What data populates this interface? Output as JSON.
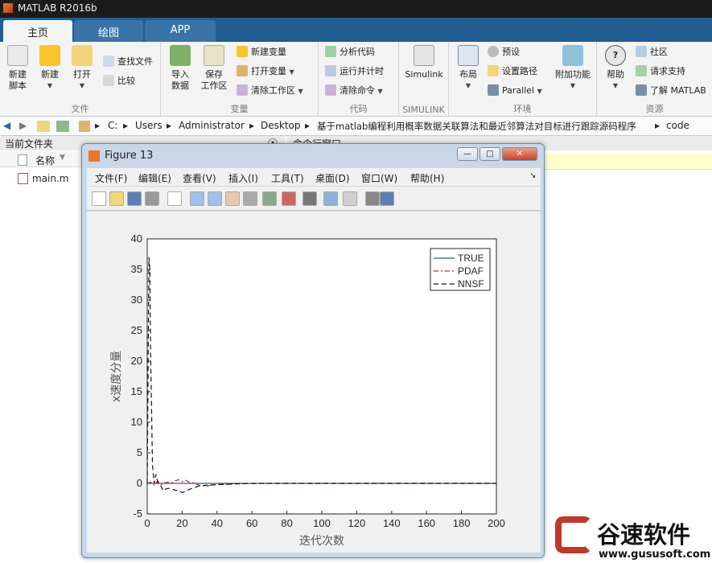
{
  "app": {
    "title": "MATLAB R2016b"
  },
  "tabs": [
    {
      "label": "主页",
      "active": true
    },
    {
      "label": "绘图",
      "active": false
    },
    {
      "label": "APP",
      "active": false
    }
  ],
  "ribbon": {
    "file": {
      "label": "文件",
      "new_script": "新建\n脚本",
      "new": "新建",
      "open": "打开",
      "find_files": "查找文件",
      "compare": "比较"
    },
    "variable": {
      "label": "变量",
      "import": "导入\n数据",
      "save_ws": "保存\n工作区",
      "new_var": "新建变量",
      "open_var": "打开变量",
      "clear_ws": "清除工作区"
    },
    "code": {
      "label": "代码",
      "analyze": "分析代码",
      "run_time": "运行并计时",
      "clear_cmd": "清除命令"
    },
    "simulink": {
      "label": "SIMULINK",
      "simulink": "Simulink"
    },
    "env": {
      "label": "环境",
      "layout": "布局",
      "prefs": "预设",
      "set_path": "设置路径",
      "parallel": "Parallel",
      "addons": "附加功能"
    },
    "resources": {
      "label": "资源",
      "help": "帮助",
      "community": "社区",
      "support": "请求支持",
      "learn": "了解 MATLAB"
    }
  },
  "address": {
    "crumbs": [
      "C:",
      "Users",
      "Administrator",
      "Desktop",
      "基于matlab编程利用概率数据关联算法和最近邻算法对目标进行跟踪源码程序",
      "code"
    ]
  },
  "current_folder": {
    "title": "当前文件夹",
    "col_name": "名称",
    "files": [
      "main.m"
    ]
  },
  "command_window": {
    "title": "命令行窗口"
  },
  "figure": {
    "title": "Figure 13",
    "menu": [
      "文件(F)",
      "编辑(E)",
      "查看(V)",
      "插入(I)",
      "工具(T)",
      "桌面(D)",
      "窗口(W)",
      "帮助(H)"
    ],
    "toolbar_icons": [
      "new-figure-icon",
      "open-file-icon",
      "save-icon",
      "print-icon",
      "pointer-icon",
      "zoom-in-icon",
      "zoom-out-icon",
      "pan-icon",
      "rotate-icon",
      "data-cursor-icon",
      "brush-icon",
      "link-icon",
      "colorbar-icon",
      "legend-icon",
      "hide-plot-tools-icon",
      "show-plot-tools-icon"
    ],
    "window_buttons": [
      "—",
      "□",
      "✕"
    ]
  },
  "chart_data": {
    "type": "line",
    "title": "",
    "xlabel": "迭代次数",
    "ylabel": "x速度分量",
    "xlim": [
      0,
      200
    ],
    "ylim": [
      -5,
      40
    ],
    "xticks": [
      0,
      20,
      40,
      60,
      80,
      100,
      120,
      140,
      160,
      180,
      200
    ],
    "yticks": [
      -5,
      0,
      5,
      10,
      15,
      20,
      25,
      30,
      35,
      40
    ],
    "legend_position": "top-right",
    "series": [
      {
        "name": "TRUE",
        "color": "#1f5fa8",
        "style": "solid",
        "x": [
          0,
          200
        ],
        "y": [
          0,
          0
        ]
      },
      {
        "name": "PDAF",
        "color": "#d42020",
        "style": "dashdot",
        "x": [
          0,
          2,
          4,
          6,
          8,
          10,
          12,
          14,
          16,
          18,
          20,
          22,
          24,
          26,
          28,
          30,
          32,
          34,
          36,
          40,
          45,
          50,
          60,
          80,
          100,
          200
        ],
        "y": [
          0,
          0.2,
          -0.3,
          0.4,
          -0.2,
          0.1,
          0.2,
          0.1,
          0.4,
          0.6,
          0.3,
          0.5,
          0.2,
          0.1,
          -0.1,
          -0.3,
          -0.4,
          -0.5,
          -0.3,
          -0.2,
          -0.15,
          -0.05,
          0,
          0,
          0,
          0
        ]
      },
      {
        "name": "NNSF",
        "color": "#111111",
        "style": "dashed",
        "x": [
          0,
          1,
          1.5,
          2,
          2.5,
          3,
          4,
          5,
          6,
          7,
          8,
          9,
          10,
          12,
          14,
          16,
          18,
          20,
          22,
          24,
          26,
          28,
          30,
          34,
          40,
          50,
          60,
          80,
          100,
          200
        ],
        "y": [
          0,
          37,
          35,
          20,
          12,
          3,
          0,
          1.5,
          0.2,
          -0.3,
          -0.5,
          -1.2,
          -1.0,
          -0.8,
          -0.9,
          -1.1,
          -1.2,
          -1.5,
          -1.3,
          -1.0,
          -0.8,
          -0.6,
          -0.4,
          -0.3,
          -0.2,
          -0.1,
          0,
          0,
          0,
          0
        ]
      }
    ]
  },
  "watermark": {
    "brand": "谷速软件",
    "url": "www.gususoft.com"
  },
  "colors": {
    "titlebar": "#1b1b1b",
    "tabstrip": "#1f5d93",
    "ribbon": "#f3f3f3",
    "figure_frame": "#c9d7e6"
  }
}
